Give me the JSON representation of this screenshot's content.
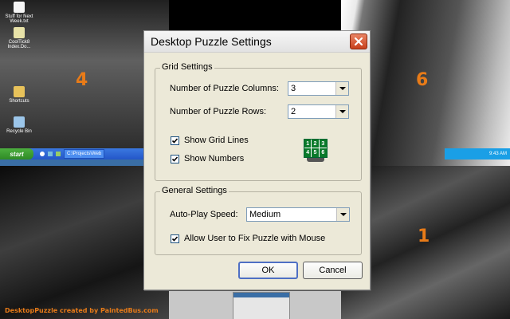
{
  "tiles": {
    "tile4_number": "4",
    "tile6_number": "6",
    "tile1_number": "1"
  },
  "desktop": {
    "icons": [
      "Stuff for Next Week.txt",
      "CoolTick8 Index.Do...",
      "Shortcuts",
      "Recycle Bin"
    ],
    "start_label": "start",
    "task_button": "C:\\Projects\\Web",
    "clock": "9:43 AM"
  },
  "credits": "DesktopPuzzle   created by PaintedBus.com",
  "dialog": {
    "title": "Desktop Puzzle Settings",
    "grid_settings": {
      "title": "Grid Settings",
      "columns_label": "Number of Puzzle Columns:",
      "columns_value": "3",
      "rows_label": "Number of Puzzle Rows:",
      "rows_value": "2",
      "show_grid_lines": "Show Grid Lines",
      "show_numbers": "Show Numbers",
      "preview_digits": [
        "1",
        "2",
        "3",
        "4",
        "5",
        "6"
      ]
    },
    "general_settings": {
      "title": "General Settings",
      "speed_label": "Auto-Play Speed:",
      "speed_value": "Medium",
      "fix_with_mouse": "Allow User to Fix Puzzle with Mouse"
    },
    "ok_label": "OK",
    "cancel_label": "Cancel"
  },
  "colors": {
    "tile_number": "#e87b18",
    "dialog_bg": "#ece9d8",
    "close_button": "#d9572f"
  }
}
